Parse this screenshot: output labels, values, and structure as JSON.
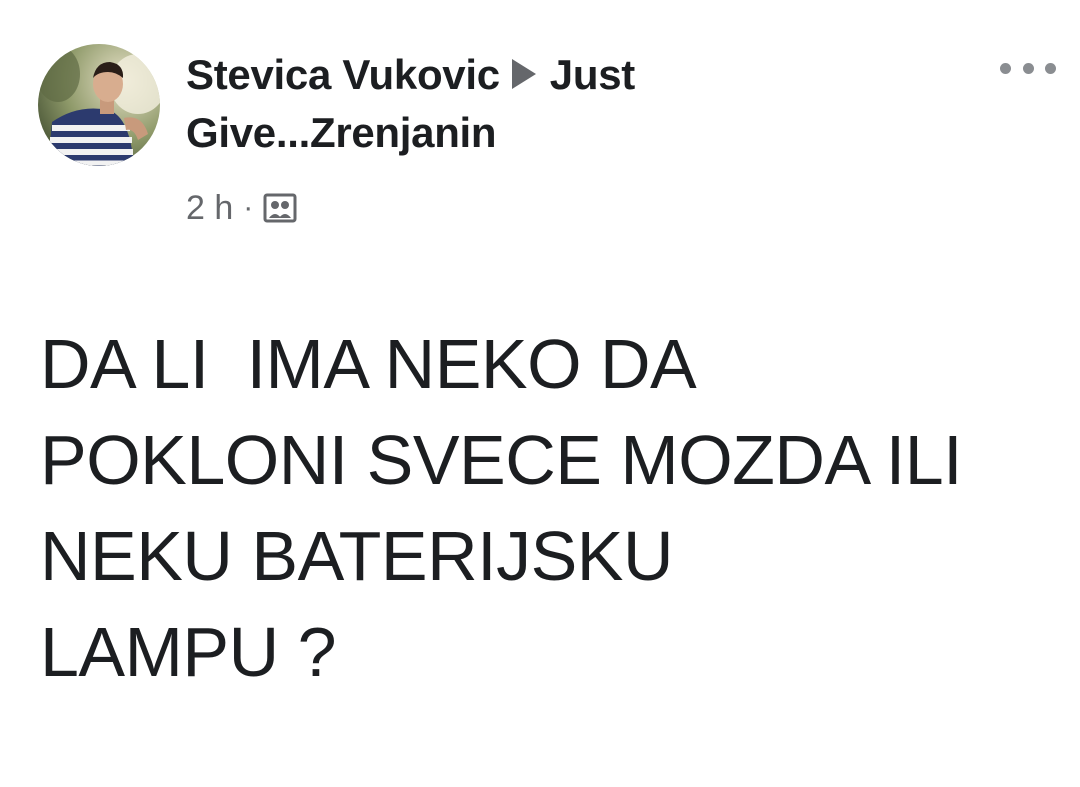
{
  "post": {
    "author": "Stevica Vukovic",
    "group_line1": "Just",
    "group_line2": "Give...Zrenjanin",
    "timestamp": "2 h",
    "separator": "·",
    "audience_icon": "group-audience-icon",
    "more_icon": "more-options-icon",
    "text": "DA LI  IMA NEKO DA\nPOKLONI SVECE MOZDA ILI\nNEKU BATERIJSKU\nLAMPU ?"
  },
  "colors": {
    "text_primary": "#1c1e21",
    "text_secondary": "#65676b",
    "background": "#ffffff"
  }
}
